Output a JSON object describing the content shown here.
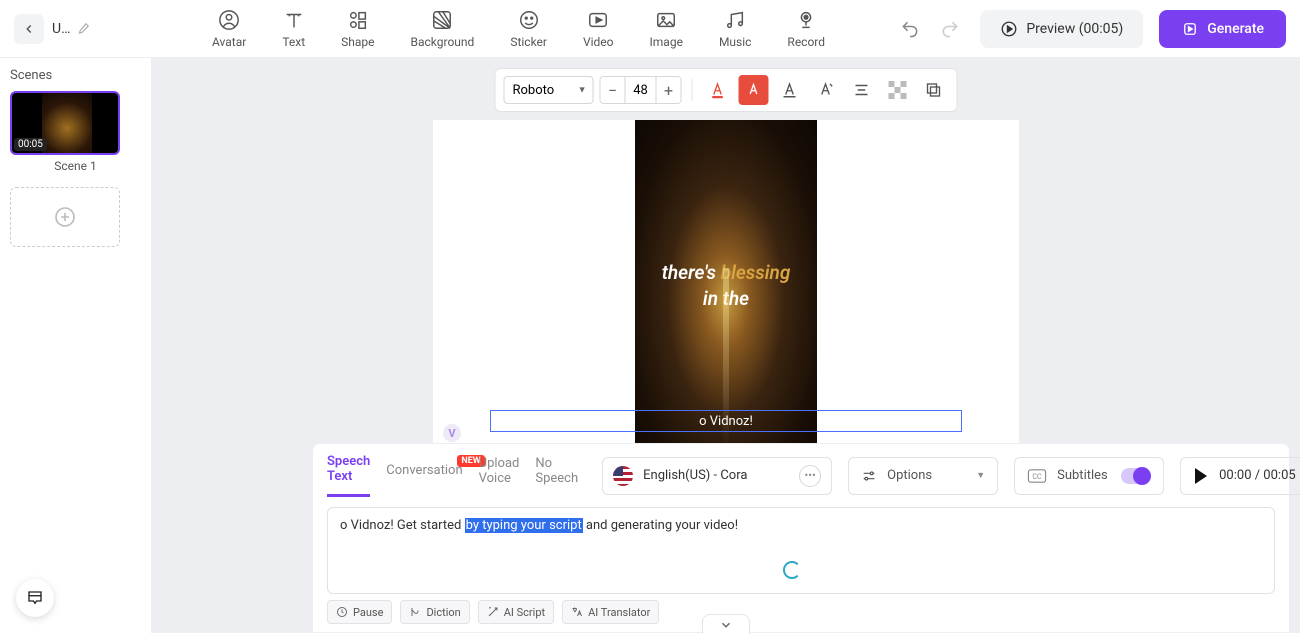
{
  "header": {
    "title": "U…",
    "tools": [
      {
        "id": "avatar",
        "label": "Avatar"
      },
      {
        "id": "text",
        "label": "Text"
      },
      {
        "id": "shape",
        "label": "Shape"
      },
      {
        "id": "background",
        "label": "Background"
      },
      {
        "id": "sticker",
        "label": "Sticker"
      },
      {
        "id": "video",
        "label": "Video"
      },
      {
        "id": "image",
        "label": "Image"
      },
      {
        "id": "music",
        "label": "Music"
      },
      {
        "id": "record",
        "label": "Record"
      }
    ],
    "preview_label": "Preview (00:05)",
    "generate_label": "Generate"
  },
  "scenes": {
    "heading": "Scenes",
    "items": [
      {
        "duration": "00:05",
        "name": "Scene 1"
      }
    ]
  },
  "text_toolbar": {
    "font": "Roboto",
    "size": "48"
  },
  "canvas": {
    "overlay": {
      "pre": "there's ",
      "em": "blessing",
      "post": "in the"
    },
    "caption": "o Vidnoz!"
  },
  "bottom": {
    "tabs": [
      {
        "id": "speech",
        "label": "Speech Text",
        "active": true
      },
      {
        "id": "conversation",
        "label": "Conversation",
        "badge": "NEW"
      },
      {
        "id": "upload",
        "label": "Upload Voice"
      },
      {
        "id": "nospeech",
        "label": "No Speech"
      }
    ],
    "voice": "English(US) - Cora",
    "options_label": "Options",
    "subtitles_label": "Subtitles",
    "playtime": "00:00 / 00:05",
    "script": {
      "pre": "o Vidnoz! Get started ",
      "hl": "by typing your script",
      "post": " and generating your video!"
    },
    "chips": [
      {
        "id": "pause",
        "label": "Pause"
      },
      {
        "id": "diction",
        "label": "Diction"
      },
      {
        "id": "aiscript",
        "label": "AI Script"
      },
      {
        "id": "aitranslator",
        "label": "AI Translator"
      }
    ]
  }
}
